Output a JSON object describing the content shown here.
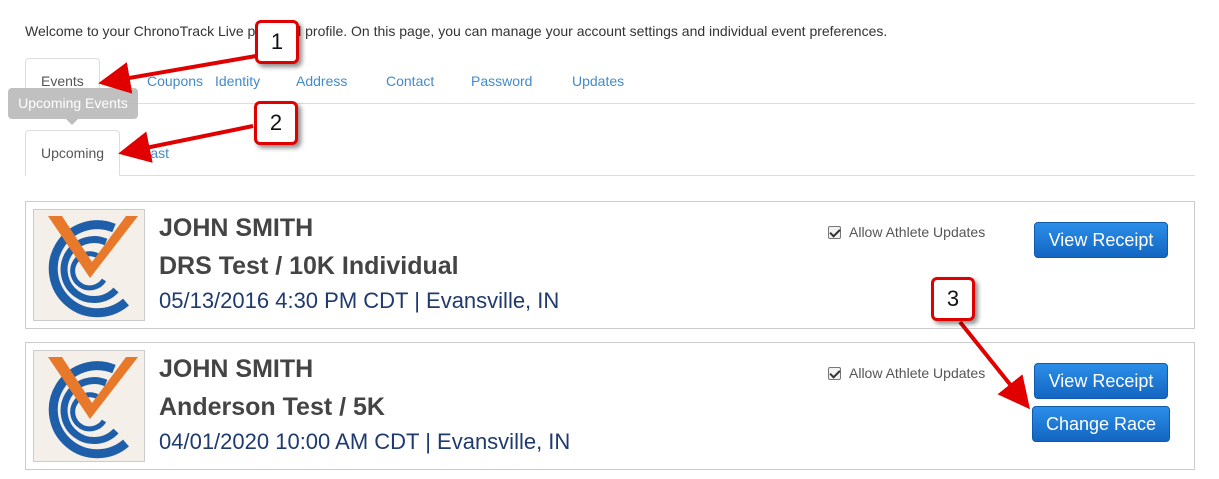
{
  "intro": "Welcome to your ChronoTrack Live personal profile. On this page, you can manage your account settings and individual event preferences.",
  "main_tabs": [
    "Events",
    "Coupons",
    "Identity",
    "Address",
    "Contact",
    "Password",
    "Updates"
  ],
  "tooltip": "Upcoming Events",
  "sub_tabs": [
    "Upcoming",
    "Past"
  ],
  "events": [
    {
      "athlete": "JOHN SMITH",
      "race": "DRS Test / 10K Individual",
      "details": "05/13/2016 4:30 PM CDT | Evansville, IN",
      "allow_updates_label": "Allow Athlete Updates",
      "allow_updates_checked": true,
      "view_receipt": "View Receipt"
    },
    {
      "athlete": "JOHN SMITH",
      "race": "Anderson Test / 5K",
      "details": "04/01/2020 10:00 AM CDT | Evansville, IN",
      "allow_updates_label": "Allow Athlete Updates",
      "allow_updates_checked": true,
      "view_receipt": "View Receipt",
      "change_race": "Change Race"
    }
  ],
  "callouts": [
    "1",
    "2",
    "3"
  ],
  "colors": {
    "link": "#428bca",
    "button": "#1a75d1",
    "callout_red": "#e00000",
    "details_text": "#1f3a6e"
  }
}
